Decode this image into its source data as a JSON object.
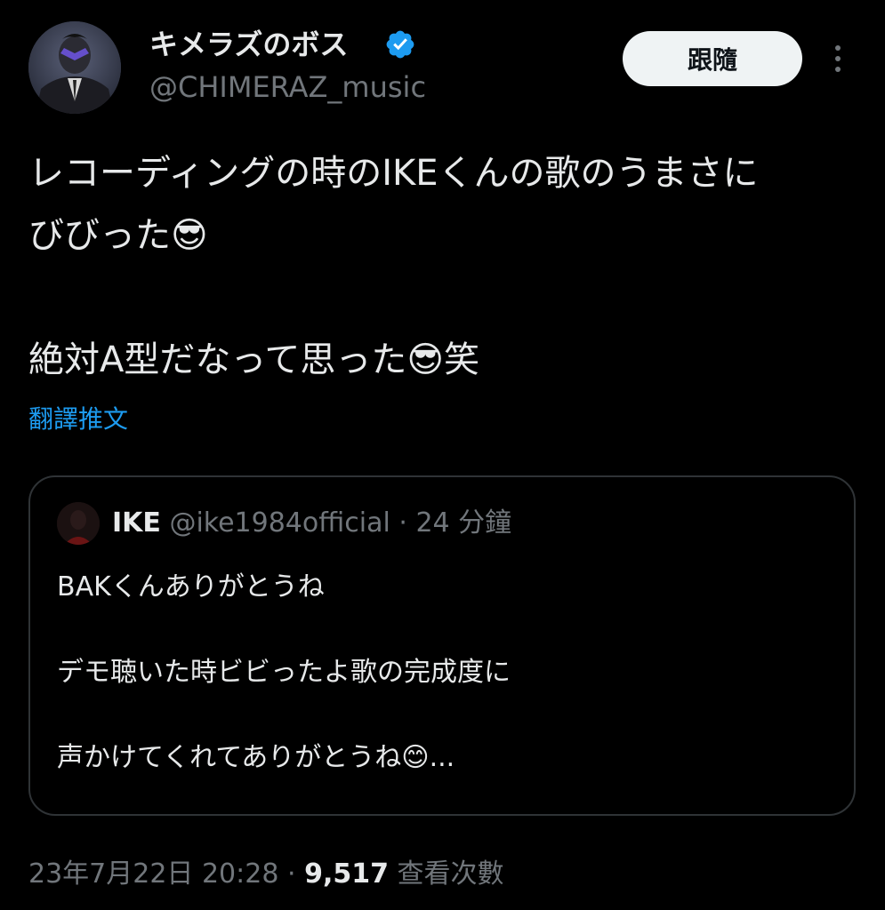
{
  "author": {
    "display_name": "キメラズのボス",
    "handle": "@CHIMERAZ_music",
    "verified_icon": "verified-badge-icon"
  },
  "actions": {
    "follow_label": "跟隨",
    "more_icon": "more-vertical-icon"
  },
  "tweet": {
    "text": "レコーディングの時のIKEくんの歌のうまさに\nびびった😎\n\n絶対A型だなって思った😎笑",
    "translate_label": "翻譯推文"
  },
  "quote": {
    "name": "IKE",
    "handle": "@ike1984official",
    "separator": "·",
    "time": "24 分鐘",
    "text": "BAKくんありがとうね\n\nデモ聴いた時ビビったよ歌の完成度に\n\n声かけてくれてありがとうね😊..."
  },
  "meta": {
    "date": "23年7月22日 20:28",
    "separator": "·",
    "views_count": "9,517",
    "views_label": "查看次數"
  },
  "colors": {
    "background": "#000000",
    "text": "#e7e9ea",
    "muted": "#71767b",
    "link": "#1d9bf0",
    "border": "#2f3336"
  }
}
